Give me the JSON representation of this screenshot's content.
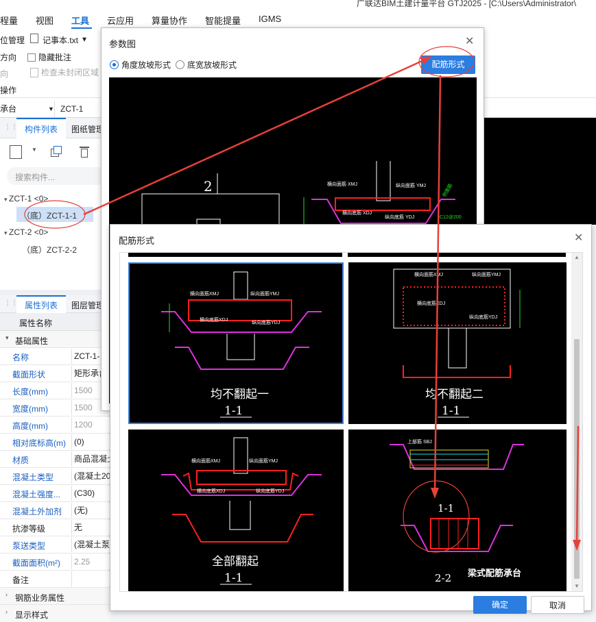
{
  "ribbon": {
    "title_fragment": "广联达BIM土建计量平台 GTJ2025 - [C:\\Users\\Administrator\\",
    "tabs": [
      "程量",
      "视图",
      "工具",
      "云应用",
      "算量协作",
      "智能提量",
      "IGMS"
    ],
    "active_tab": "工具",
    "row1": {
      "item_a": "位管理",
      "item_b": "记事本.txt",
      "item_b_arrow": "▾"
    },
    "row2": {
      "item_a": "方向",
      "item_b": "隐藏批注"
    },
    "row3": {
      "item_a": "向",
      "item_b": "检查未封闭区域"
    },
    "group_label": "操作",
    "selector_type": "承台",
    "selector_element": "ZCT-1"
  },
  "component_panel": {
    "tabs": [
      "构件列表",
      "图纸管理"
    ],
    "search_placeholder": "搜索构件...",
    "tree": [
      {
        "label": "ZCT-1 <0>",
        "children": [
          "（底）ZCT-1-1"
        ]
      },
      {
        "label": "ZCT-2 <0>",
        "children": [
          "（底）ZCT-2-2"
        ]
      }
    ]
  },
  "property_panel": {
    "tabs": [
      "属性列表",
      "图层管理"
    ],
    "header": "属性名称",
    "section": "基础属性",
    "rows": [
      {
        "name": "名称",
        "value": "ZCT-1-"
      },
      {
        "name": "截面形状",
        "value": "矩形承台"
      },
      {
        "name": "长度(mm)",
        "value": "1500"
      },
      {
        "name": "宽度(mm)",
        "value": "1500"
      },
      {
        "name": "高度(mm)",
        "value": "1200"
      },
      {
        "name": "相对底标高(m)",
        "value": "(0)"
      },
      {
        "name": "材质",
        "value": "商品混凝土"
      },
      {
        "name": "混凝土类型",
        "value": "(混凝土20"
      },
      {
        "name": "混凝土强度...",
        "value": "(C30)"
      },
      {
        "name": "混凝土外加剂",
        "value": "(无)"
      },
      {
        "name": "抗渗等级",
        "value": "无"
      },
      {
        "name": "泵送类型",
        "value": "(混凝土泵)"
      },
      {
        "name": "截面面积(m²)",
        "value": "2.25"
      },
      {
        "name": "备注",
        "value": ""
      }
    ],
    "section2": "钢筋业务属性",
    "section3": "显示样式"
  },
  "param_dialog": {
    "title": "参数图",
    "radio1": "角度放坡形式",
    "radio2": "底宽放坡形式",
    "button": "配筋形式",
    "drawing_number": "2",
    "labels": {
      "hxmj": "横向面筋 XMJ",
      "zxmj": "纵向面筋 YMJ",
      "hxdj": "横向底筋 XDJ",
      "zxdj": "纵向底筋 YDJ",
      "c12": "C12@200",
      "side": "侧面筋"
    }
  },
  "rebar_dialog": {
    "title": "配筋形式",
    "options": [
      {
        "name": "均不翻起一",
        "section": "1-1"
      },
      {
        "name": "均不翻起二",
        "section": "1-1"
      },
      {
        "name": "全部翻起",
        "section": "1-1"
      },
      {
        "name": "梁式配筋承台",
        "section": "1-1",
        "section2": "2-2"
      }
    ],
    "ok": "确定",
    "cancel": "取消"
  },
  "colors": {
    "accent": "#2b7de0",
    "annotation_red": "#e8403a",
    "cad_bg": "#000000",
    "rebar_red": "#ff2020",
    "rebar_magenta": "#e030e0",
    "cad_green": "#20e020",
    "cad_yellow": "#e0e020"
  }
}
